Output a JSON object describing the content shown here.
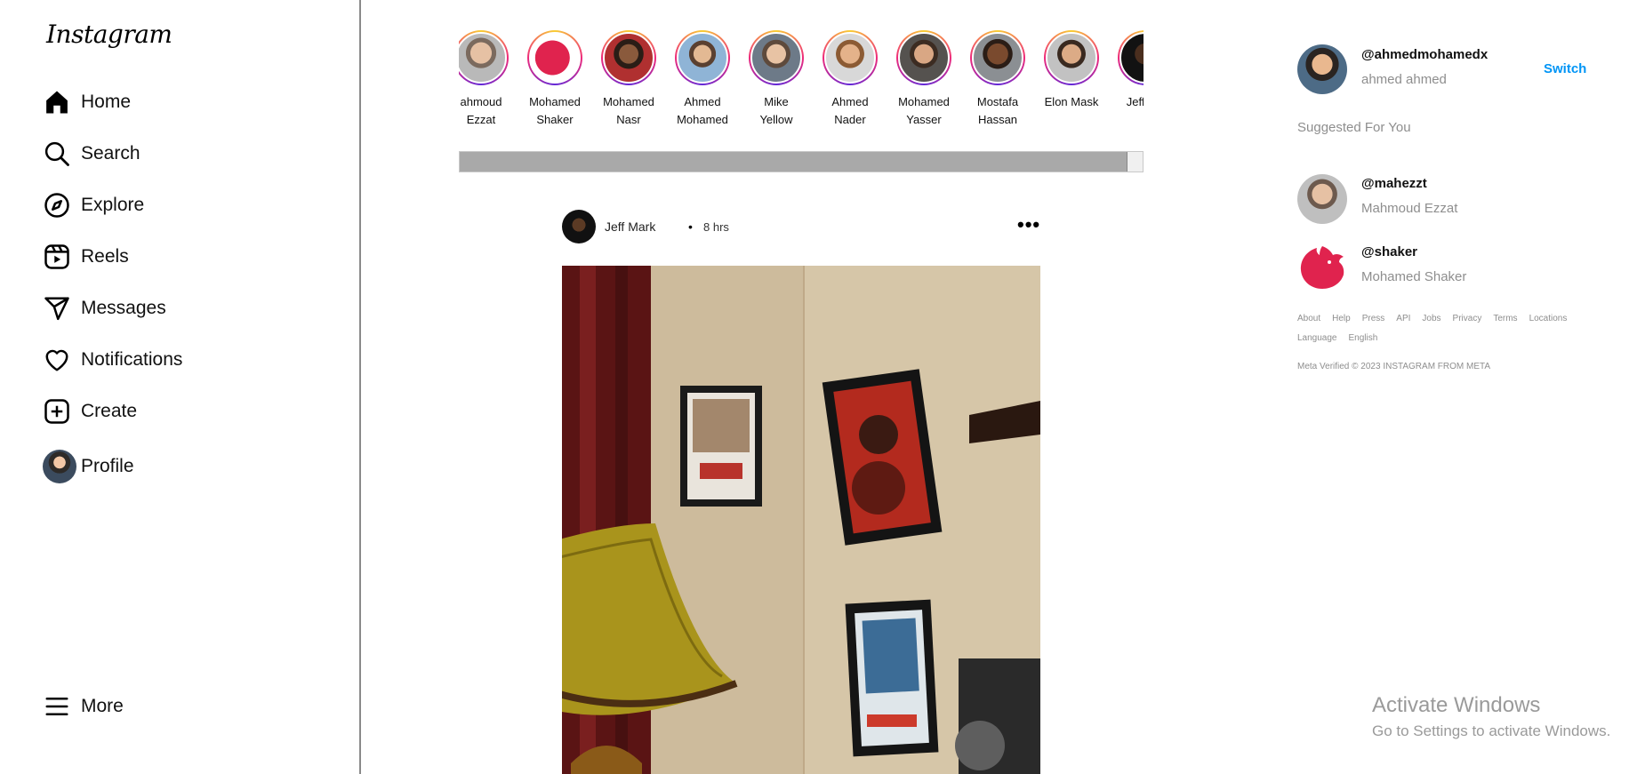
{
  "sidebar": {
    "logo": "Instagram",
    "items": [
      {
        "label": "Home"
      },
      {
        "label": "Search"
      },
      {
        "label": "Explore"
      },
      {
        "label": "Reels"
      },
      {
        "label": "Messages"
      },
      {
        "label": "Notifications"
      },
      {
        "label": "Create"
      },
      {
        "label": "Profile"
      }
    ],
    "more": "More"
  },
  "stories": [
    {
      "line1": "ahmoud",
      "line2": "Ezzat"
    },
    {
      "line1": "Mohamed",
      "line2": "Shaker"
    },
    {
      "line1": "Mohamed",
      "line2": "Nasr"
    },
    {
      "line1": "Ahmed",
      "line2": "Mohamed"
    },
    {
      "line1": "Mike",
      "line2": "Yellow"
    },
    {
      "line1": "Ahmed",
      "line2": "Nader"
    },
    {
      "line1": "Mohamed",
      "line2": "Yasser"
    },
    {
      "line1": "Mostafa",
      "line2": "Hassan"
    },
    {
      "line1": "Elon Mask",
      "line2": ""
    },
    {
      "line1": "Jeff Ma",
      "line2": ""
    }
  ],
  "post": {
    "username": "Jeff Mark",
    "dot": "•",
    "time": "8 hrs",
    "more": "•••"
  },
  "current_user": {
    "username": "@ahmedmohamedx",
    "name": "ahmed ahmed",
    "switch": "Switch"
  },
  "suggestions": {
    "title": "Suggested For You",
    "users": [
      {
        "username": "@mahezzt",
        "name": "Mahmoud Ezzat"
      },
      {
        "username": "@shaker",
        "name": "Mohamed Shaker"
      }
    ]
  },
  "footer": {
    "links": [
      "About",
      "Help",
      "Press",
      "API",
      "Jobs",
      "Privacy",
      "Terms",
      "Locations",
      "Language",
      "English"
    ],
    "copyright": "Meta Verified © 2023 INSTAGRAM FROM META"
  },
  "watermark": {
    "title": "Activate Windows",
    "subtitle": "Go to Settings to activate Windows."
  },
  "colors": {
    "accent": "#0095f6",
    "nest_red": "#e0234e"
  }
}
